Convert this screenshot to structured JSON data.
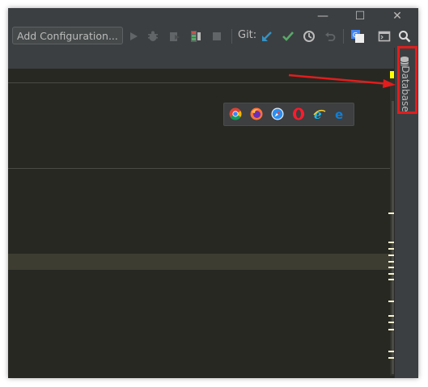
{
  "toolbar": {
    "add_configuration_label": "Add Configuration...",
    "git_label": "Git:"
  },
  "right_panel": {
    "database_tab_label": "Database"
  },
  "browsers": [
    "Chrome",
    "Firefox",
    "Safari",
    "Opera",
    "Internet Explorer",
    "Edge"
  ],
  "colors": {
    "window_bg": "#3c3f41",
    "editor_bg": "#272822",
    "highlight_red": "#e11d1d",
    "marker_yellow": "#ffff00",
    "git_update_blue": "#3592c4",
    "git_commit_green": "#59a869"
  },
  "icons": [
    "minimize-icon",
    "maximize-icon",
    "close-icon",
    "run-icon",
    "debug-icon",
    "coverage-icon",
    "profile-icon",
    "stop-icon",
    "git-update-icon",
    "git-commit-icon",
    "history-icon",
    "revert-icon",
    "translate-icon",
    "terminal-icon",
    "search-icon",
    "database-icon"
  ]
}
